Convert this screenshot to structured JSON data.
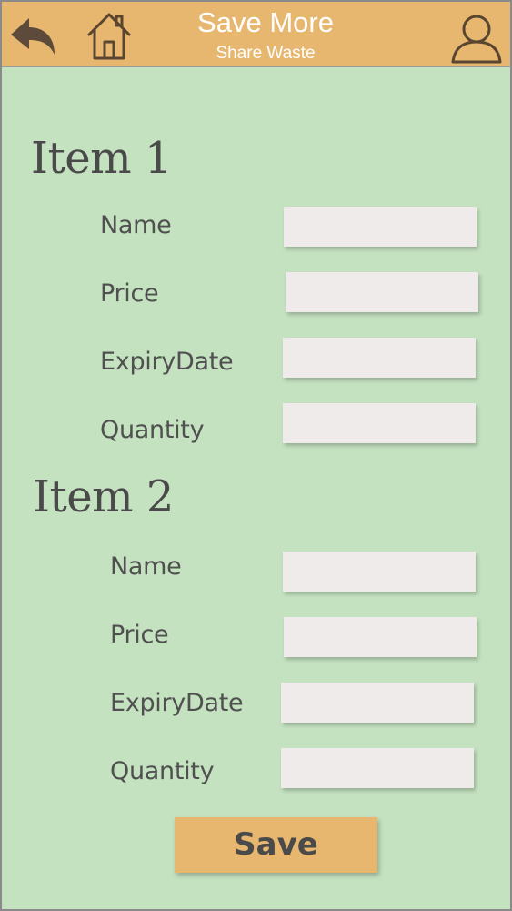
{
  "header": {
    "title": "Save More",
    "subtitle": "Share Waste",
    "back_icon": "back-arrow-icon",
    "home_icon": "home-icon",
    "user_icon": "user-icon"
  },
  "items": [
    {
      "title": "Item 1",
      "fields": [
        {
          "label": "Name",
          "value": ""
        },
        {
          "label": "Price",
          "value": ""
        },
        {
          "label": "ExpiryDate",
          "value": ""
        },
        {
          "label": "Quantity",
          "value": ""
        }
      ]
    },
    {
      "title": "Item 2",
      "fields": [
        {
          "label": "Name",
          "value": ""
        },
        {
          "label": "Price",
          "value": ""
        },
        {
          "label": "ExpiryDate",
          "value": ""
        },
        {
          "label": "Quantity",
          "value": ""
        }
      ]
    }
  ],
  "save_label": "Save",
  "colors": {
    "header": "#e8b76f",
    "background": "#c4e2c0",
    "input": "#efebeb",
    "text": "#505050",
    "icon_stroke": "#5a4630"
  }
}
